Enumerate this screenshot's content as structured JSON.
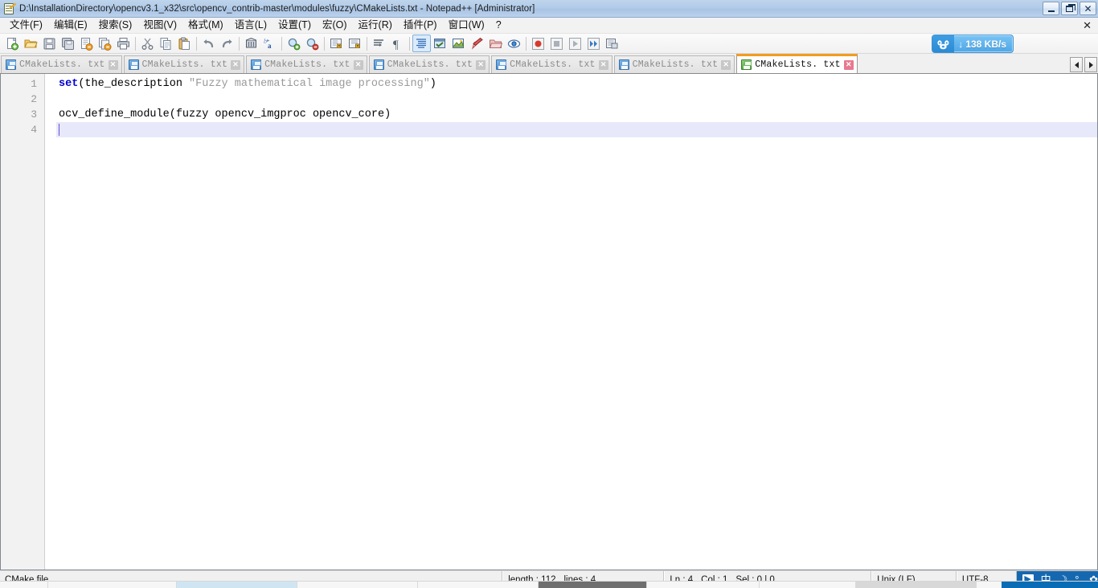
{
  "window": {
    "title": "D:\\InstallationDirectory\\opencv3.1_x32\\src\\opencv_contrib-master\\modules\\fuzzy\\CMakeLists.txt - Notepad++ [Administrator]",
    "icon": "notepad-plus-plus-icon",
    "controls": {
      "minimize": "_",
      "restore": "❐",
      "close": "✕"
    }
  },
  "menubar": {
    "items": [
      {
        "label": "文件(F)",
        "name": "menu-file"
      },
      {
        "label": "编辑(E)",
        "name": "menu-edit"
      },
      {
        "label": "搜索(S)",
        "name": "menu-search"
      },
      {
        "label": "视图(V)",
        "name": "menu-view"
      },
      {
        "label": "格式(M)",
        "name": "menu-format"
      },
      {
        "label": "语言(L)",
        "name": "menu-language"
      },
      {
        "label": "设置(T)",
        "name": "menu-settings"
      },
      {
        "label": "宏(O)",
        "name": "menu-macro"
      },
      {
        "label": "运行(R)",
        "name": "menu-run"
      },
      {
        "label": "插件(P)",
        "name": "menu-plugins"
      },
      {
        "label": "窗口(W)",
        "name": "menu-window"
      },
      {
        "label": "?",
        "name": "menu-help"
      }
    ],
    "close_document": "✕"
  },
  "toolbar": {
    "buttons": [
      "new-file-icon",
      "open-file-icon",
      "save-icon",
      "save-all-icon",
      "close-file-icon",
      "close-all-icon",
      "print-icon",
      "SEP",
      "cut-icon",
      "copy-icon",
      "paste-icon",
      "SEP",
      "undo-icon",
      "redo-icon",
      "SEP",
      "find-icon",
      "replace-icon",
      "SEP",
      "zoom-in-icon",
      "zoom-out-icon",
      "SEP",
      "sync-vertical-scroll-icon",
      "sync-horizontal-scroll-icon",
      "SEP",
      "word-wrap-icon",
      "show-all-chars-icon",
      "SEP",
      "indent-guide-icon",
      "user-defined-dialog-icon",
      "document-map-icon",
      "function-list-icon",
      "folder-as-workspace-icon",
      "monitoring-icon",
      "SEP",
      "record-macro-icon",
      "stop-recording-icon",
      "play-macro-icon",
      "run-macro-multiple-icon",
      "save-macro-icon"
    ]
  },
  "speed_widget": {
    "name": "baidu-netdisk-speed",
    "logo": "cloud-icon",
    "arrow": "download-arrow-icon",
    "text": "138 KB/s",
    "bg_color": "#4ea7e8"
  },
  "tabs": {
    "items": [
      {
        "label": "CMakeLists. txt",
        "active": false
      },
      {
        "label": "CMakeLists. txt",
        "active": false
      },
      {
        "label": "CMakeLists. txt",
        "active": false
      },
      {
        "label": "CMakeLists. txt",
        "active": false
      },
      {
        "label": "CMakeLists. txt",
        "active": false
      },
      {
        "label": "CMakeLists. txt",
        "active": false
      },
      {
        "label": "CMakeLists. txt",
        "active": true
      }
    ],
    "scroll_left": "◀",
    "scroll_right": "▶",
    "active_accent_color": "#f29c1f"
  },
  "editor": {
    "line_numbers": [
      "1",
      "2",
      "3",
      "4"
    ],
    "current_line": 4,
    "lines": [
      {
        "tokens": [
          {
            "text": "set",
            "type": "kw"
          },
          {
            "text": "(the_description ",
            "type": "plain"
          },
          {
            "text": "\"Fuzzy mathematical image processing\"",
            "type": "str"
          },
          {
            "text": ")",
            "type": "plain"
          }
        ]
      },
      {
        "tokens": [
          {
            "text": "",
            "type": "plain"
          }
        ]
      },
      {
        "tokens": [
          {
            "text": "ocv_define_module(fuzzy opencv_imgproc opencv_core)",
            "type": "plain"
          }
        ]
      },
      {
        "tokens": [
          {
            "text": "",
            "type": "plain"
          }
        ]
      }
    ],
    "keyword_color": "#0000d0",
    "string_color": "#9a9a9a",
    "current_line_bg": "#e8e8fb"
  },
  "statusbar": {
    "doc_type": "CMake file",
    "length_label": "length : 112",
    "lines_label": "lines : 4",
    "ln_label": "Ln : 4",
    "col_label": "Col : 1",
    "sel_label": "Sel : 0 | 0",
    "eol": "Unix (LF)",
    "encoding": "UTF-8",
    "ime": {
      "bg_color": "#1568b0",
      "icons": [
        "ime-logo-icon",
        "chinese-mode-icon",
        "half-width-icon",
        "punctuation-icon",
        "ime-settings-icon"
      ],
      "glyphs": [
        "▶",
        "中",
        "☽",
        "°,",
        "✿"
      ]
    }
  }
}
